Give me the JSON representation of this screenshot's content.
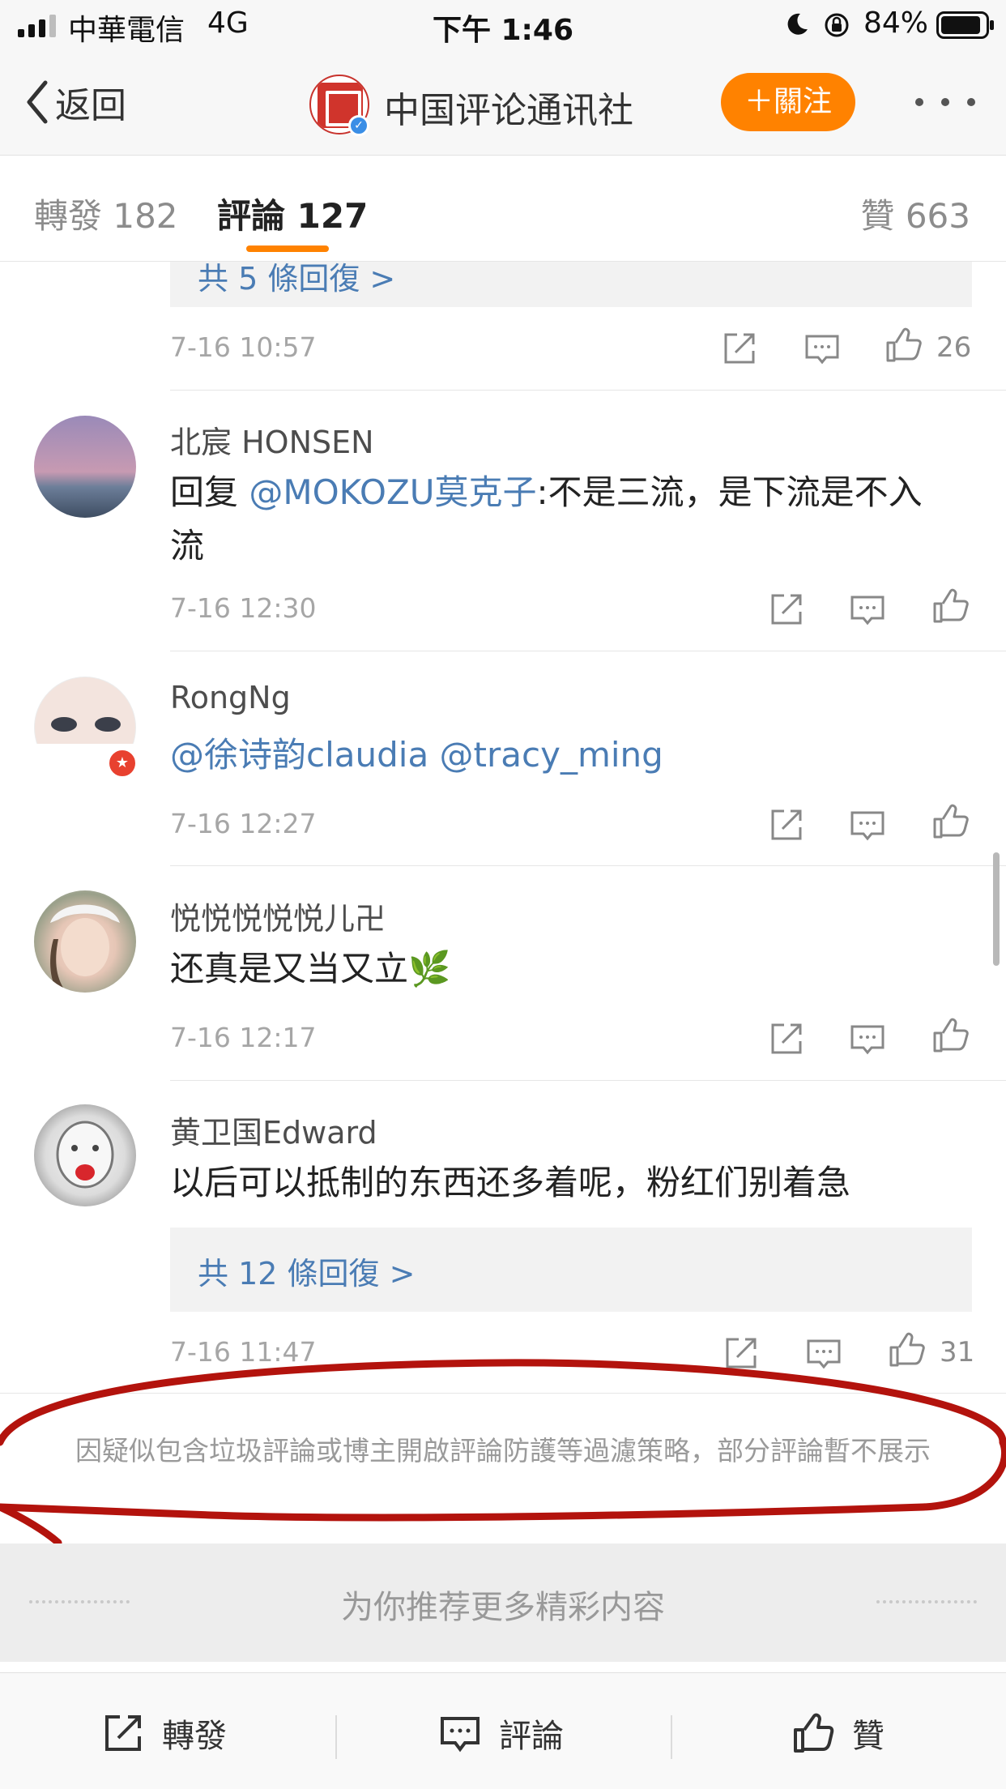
{
  "status_bar": {
    "carrier": "中華電信",
    "network": "4G",
    "time": "下午 1:46",
    "battery": "84%"
  },
  "nav": {
    "back_label": "返回",
    "title": "中国评论通讯社",
    "follow_label": "＋關注"
  },
  "tabs": {
    "repost": "轉發 182",
    "comment": "評論 127",
    "like": "贊 663"
  },
  "comments": [
    {
      "replies_link": "共 5 條回復 >",
      "time": "7-16 10:57",
      "likes": "26"
    },
    {
      "user": "北宸 HONSEN",
      "text_prefix": "回复 ",
      "mention": "@MOKOZU莫克子",
      "text_suffix": ":不是三流，是下流是不入流",
      "time": "7-16 12:30"
    },
    {
      "user": "RongNg",
      "mentions": "@徐诗韵claudia @tracy_ming",
      "time": "7-16 12:27"
    },
    {
      "user": "悦悦悦悦悦儿卍",
      "text": "还真是又当又立🌿",
      "time": "7-16 12:17"
    },
    {
      "user": "黄卫国Edward",
      "text": "以后可以抵制的东西还多着呢，粉红们别着急",
      "replies_link": "共 12 條回復 >",
      "time": "7-16 11:47",
      "likes": "31"
    }
  ],
  "notice": "因疑似包含垃圾評論或博主開啟評論防護等過濾策略，部分評論暫不展示",
  "recommend": "为你推荐更多精彩内容",
  "bottom_bar": {
    "repost": "轉發",
    "comment": "評論",
    "like": "贊"
  },
  "colors": {
    "accent": "#ff8200",
    "link": "#4a7cb4",
    "annotation": "#b3130d"
  }
}
